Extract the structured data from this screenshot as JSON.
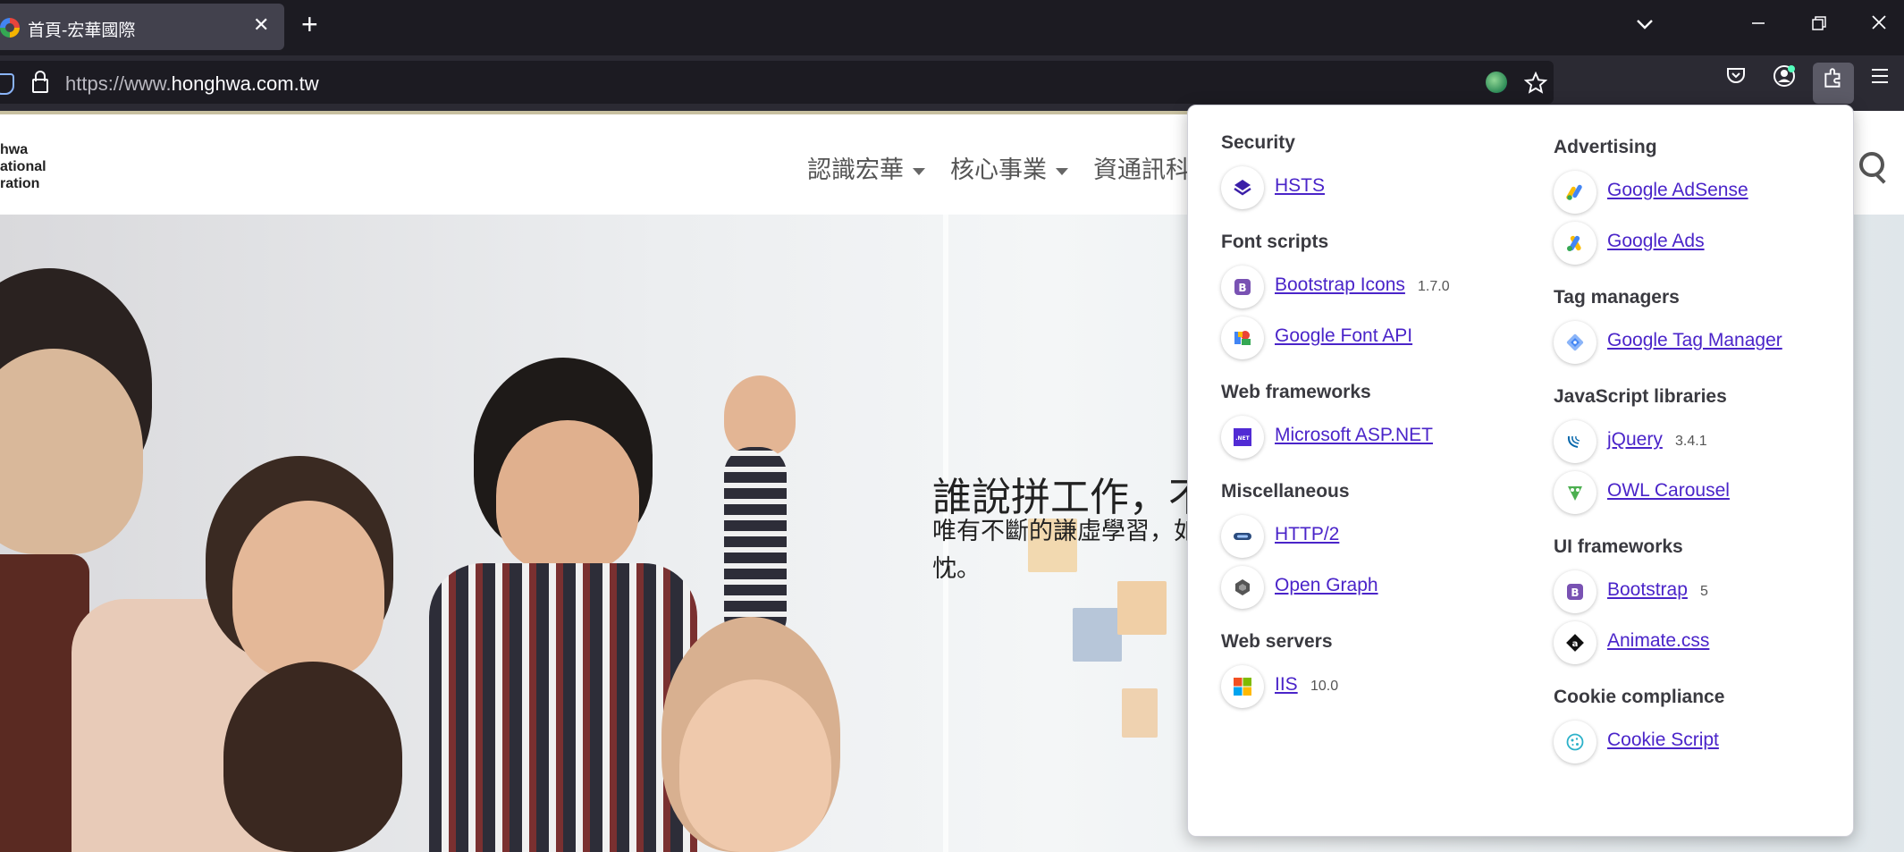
{
  "browser": {
    "tab_title": "首頁-宏華國際",
    "tab_close": "✕",
    "new_tab": "+",
    "url_prefix": "https://www.",
    "url_host": "honghwa.com.tw",
    "icons": [
      "tracking-shield-icon",
      "lock-icon",
      "globe-icon",
      "bookmark-star-icon",
      "pocket-icon",
      "account-icon",
      "extensions-icon",
      "menu-icon"
    ]
  },
  "site": {
    "logo_lines": [
      "hwa",
      "ational",
      "ration"
    ],
    "menu": [
      {
        "label": "認識宏華",
        "caret": true
      },
      {
        "label": "核心事業",
        "caret": true
      },
      {
        "label": "資通訊科",
        "caret": false
      }
    ],
    "hero_title": "誰說拼工作，不",
    "hero_sub_line1": "唯有不斷的謙虛學習，如",
    "hero_sub_line2": "忱。"
  },
  "popup": {
    "left": [
      {
        "category": "Security",
        "techs": [
          {
            "name": "HSTS",
            "version": "",
            "icon": "hsts-icon"
          }
        ]
      },
      {
        "category": "Font scripts",
        "techs": [
          {
            "name": "Bootstrap Icons",
            "version": "1.7.0",
            "icon": "bootstrap-icons-icon"
          },
          {
            "name": "Google Font API",
            "version": "",
            "icon": "google-font-api-icon"
          }
        ]
      },
      {
        "category": "Web frameworks",
        "techs": [
          {
            "name": "Microsoft ASP.NET",
            "version": "",
            "icon": "aspnet-icon"
          }
        ]
      },
      {
        "category": "Miscellaneous",
        "techs": [
          {
            "name": "HTTP/2",
            "version": "",
            "icon": "http2-icon"
          },
          {
            "name": "Open Graph",
            "version": "",
            "icon": "open-graph-icon"
          }
        ]
      },
      {
        "category": "Web servers",
        "techs": [
          {
            "name": "IIS",
            "version": "10.0",
            "icon": "iis-icon"
          }
        ]
      }
    ],
    "right": [
      {
        "category": "Advertising",
        "techs": [
          {
            "name": "Google AdSense",
            "version": "",
            "icon": "google-adsense-icon"
          },
          {
            "name": "Google Ads",
            "version": "",
            "icon": "google-ads-icon"
          }
        ]
      },
      {
        "category": "Tag managers",
        "techs": [
          {
            "name": "Google Tag Manager",
            "version": "",
            "icon": "google-tag-manager-icon"
          }
        ]
      },
      {
        "category": "JavaScript libraries",
        "techs": [
          {
            "name": "jQuery",
            "version": "3.4.1",
            "icon": "jquery-icon"
          },
          {
            "name": "OWL Carousel",
            "version": "",
            "icon": "owl-carousel-icon"
          }
        ]
      },
      {
        "category": "UI frameworks",
        "techs": [
          {
            "name": "Bootstrap",
            "version": "5",
            "icon": "bootstrap-icon"
          },
          {
            "name": "Animate.css",
            "version": "",
            "icon": "animate-css-icon"
          }
        ]
      },
      {
        "category": "Cookie compliance",
        "techs": [
          {
            "name": "Cookie Script",
            "version": "",
            "icon": "cookie-script-icon"
          }
        ]
      }
    ]
  },
  "colors": {
    "link": "#4a24c9",
    "chrome_dark": "#1c1b22",
    "chrome_mid": "#2b2a33"
  }
}
